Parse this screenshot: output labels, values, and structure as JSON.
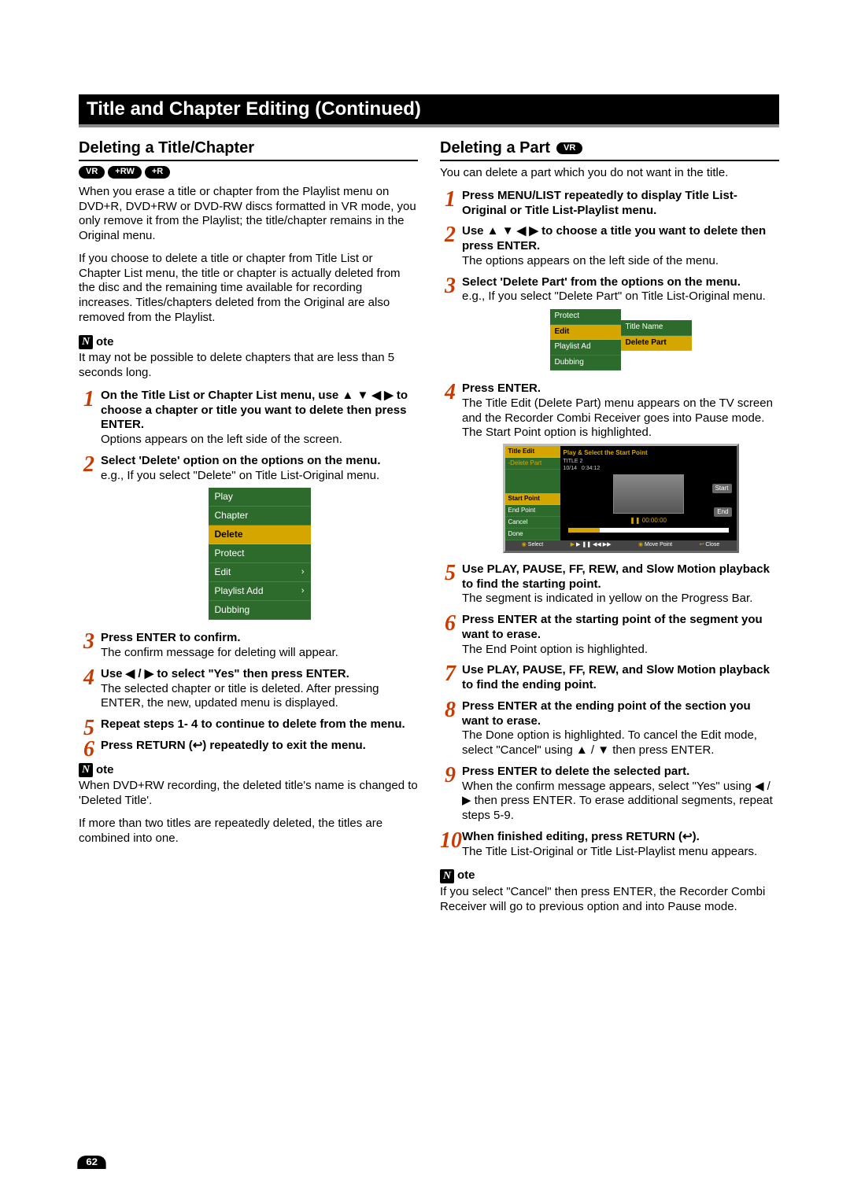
{
  "page_title": "Title and Chapter Editing (Continued)",
  "page_number": "62",
  "left": {
    "heading": "Deleting a Title/Chapter",
    "pills": [
      "VR",
      "+RW",
      "+R"
    ],
    "intro1": "When you erase a title or chapter from the Playlist menu on DVD+R, DVD+RW or DVD-RW discs formatted in VR mode, you only remove it from the Playlist; the title/chapter remains in the Original menu.",
    "intro2": "If you choose to delete a title or chapter from Title List or Chapter List menu, the title or chapter is actually deleted from the disc and the remaining time available for recording increases. Titles/chapters deleted from the Original are also removed from the Playlist.",
    "note1_label": "ote",
    "note1_text": "It may not be possible to delete chapters that are less than 5 seconds long.",
    "steps": [
      {
        "lead": "On the Title List or Chapter List menu, use ▲ ▼ ◀ ▶ to choose a chapter or title you want to delete then press ENTER.",
        "body": "Options appears on the left side of the screen."
      },
      {
        "lead": "Select 'Delete' option on the options on the menu.",
        "body": "e.g., If you select \"Delete\" on Title List-Original menu."
      },
      {
        "lead": "Press ENTER to confirm.",
        "body": "The confirm message for deleting will appear."
      },
      {
        "lead": "Use ◀ / ▶ to select \"Yes\" then press ENTER.",
        "body": "The selected chapter or title is deleted. After pressing ENTER, the new, updated menu is displayed."
      },
      {
        "lead": "Repeat steps 1- 4 to continue to delete from the menu.",
        "body": ""
      },
      {
        "lead": "Press RETURN (↩) repeatedly to exit the menu.",
        "body": ""
      }
    ],
    "option_menu": [
      "Play",
      "Chapter",
      "Delete",
      "Protect",
      "Edit",
      "Playlist Add",
      "Dubbing"
    ],
    "note2_label": "ote",
    "note2_p1": "When DVD+RW recording, the deleted title's name is changed to 'Deleted Title'.",
    "note2_p2": "If more than two titles are repeatedly deleted, the titles are combined into one."
  },
  "right": {
    "heading": "Deleting a Part",
    "pill": "VR",
    "intro": "You can delete a part which you do not want in the title.",
    "steps": [
      {
        "lead": "Press MENU/LIST repeatedly to display Title List-Original or Title List-Playlist menu.",
        "body": ""
      },
      {
        "lead": "Use ▲ ▼ ◀ ▶ to choose a title you want to delete then press ENTER.",
        "body": "The options appears on the left side of the menu."
      },
      {
        "lead": "Select 'Delete Part' from the options on the menu.",
        "body": "e.g., If you select \"Delete Part\" on Title List-Original menu."
      },
      {
        "lead": "Press ENTER.",
        "body": "The Title Edit (Delete Part) menu appears on the TV screen and the Recorder Combi Receiver goes into Pause mode.\nThe Start Point option is highlighted."
      },
      {
        "lead": "Use PLAY, PAUSE, FF, REW, and Slow Motion playback to find the starting point.",
        "body": "The segment is indicated in yellow on the Progress Bar."
      },
      {
        "lead": "Press ENTER at the starting point of the segment you want to erase.",
        "body": "The End Point option is highlighted."
      },
      {
        "lead": "Use PLAY, PAUSE, FF, REW, and Slow Motion playback to find the ending point.",
        "body": ""
      },
      {
        "lead": "Press ENTER at the ending point of the section you want to erase.",
        "body": "The Done option is highlighted.\nTo cancel the Edit mode, select \"Cancel\" using ▲ / ▼ then press ENTER."
      },
      {
        "lead": "Press ENTER to delete the selected part.",
        "body": "When the confirm message appears, select \"Yes\" using ◀ / ▶ then press ENTER.\nTo erase additional segments, repeat steps 5-9."
      },
      {
        "lead": "When finished editing, press RETURN (↩).",
        "body": "The Title List-Original or Title List-Playlist menu appears."
      }
    ],
    "mini_menu_left": [
      "Protect",
      "Edit",
      "Playlist Ad",
      "Dubbing"
    ],
    "mini_menu_right": [
      "Title Name",
      "Delete Part"
    ],
    "tv": {
      "side_head": "Title Edit",
      "side_sub": "-Delete Part",
      "side_items": [
        "Start Point",
        "End Point",
        "Cancel",
        "Done"
      ],
      "main_top": "Play & Select the Start Point",
      "title2": "TITLE 2",
      "date": "10/14",
      "dur": "0:34:12",
      "start": "Start",
      "end": "End",
      "time": "00:00:00",
      "foot": [
        "Select",
        "Move Point",
        "Close"
      ],
      "foot_play": "▶ ❚❚ ◀◀ ▶▶"
    },
    "note_label": "ote",
    "note_text": "If you select \"Cancel\" then press ENTER, the Recorder Combi Receiver will go to previous option and into Pause mode."
  }
}
